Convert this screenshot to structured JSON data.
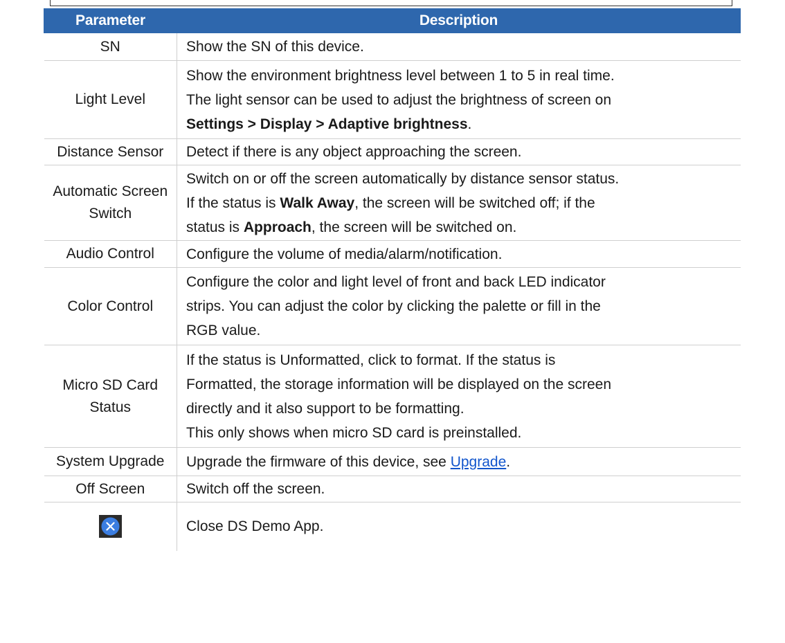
{
  "table": {
    "headers": [
      "Parameter",
      "Description"
    ],
    "rows": [
      {
        "param": "SN",
        "desc": [
          "Show the SN of this device."
        ]
      },
      {
        "param": "Light Level",
        "desc": [
          "Show the environment brightness level between 1 to 5 in real time.",
          "The light sensor can be used to adjust the brightness of screen on"
        ],
        "desc_bold": "Settings > Display > Adaptive brightness",
        "desc_tail": "."
      },
      {
        "param": "Distance Sensor",
        "desc": [
          "Detect if there is any object approaching the screen."
        ]
      },
      {
        "param_lines": [
          "Automatic Screen",
          "Switch"
        ],
        "desc": [
          "Switch on or off the screen automatically by distance sensor status."
        ],
        "line2": {
          "a": "If the status is ",
          "b": "Walk Away",
          "c": ", the screen will be switched off; if the"
        },
        "line3": {
          "a": "status is ",
          "b": "Approach",
          "c": ", the screen will be switched on."
        }
      },
      {
        "param": "Audio Control",
        "desc": [
          "Configure the volume of media/alarm/notification."
        ]
      },
      {
        "param": "Color Control",
        "desc": [
          "Configure the color and light level of front and back LED indicator",
          "strips. You can adjust the color by clicking the palette or fill in the",
          "RGB value."
        ]
      },
      {
        "param_lines": [
          "Micro SD Card",
          "Status"
        ],
        "desc": [
          "If the status is Unformatted, click to format. If the status is",
          "Formatted, the storage information will be displayed on the screen",
          "directly and it also support to be formatting.",
          "This only shows when micro SD card is preinstalled."
        ]
      },
      {
        "param": "System Upgrade",
        "desc_pre": "Upgrade the firmware of this device, see ",
        "link": "Upgrade",
        "desc_post": "."
      },
      {
        "param": "Off Screen",
        "desc": [
          "Switch off the screen."
        ]
      },
      {
        "param_icon": "close-circle-icon",
        "desc": [
          "Close DS Demo App."
        ]
      }
    ]
  },
  "colors": {
    "header_bg": "#2e67ad",
    "link": "#1155cc",
    "icon_blue": "#3b7de0"
  }
}
